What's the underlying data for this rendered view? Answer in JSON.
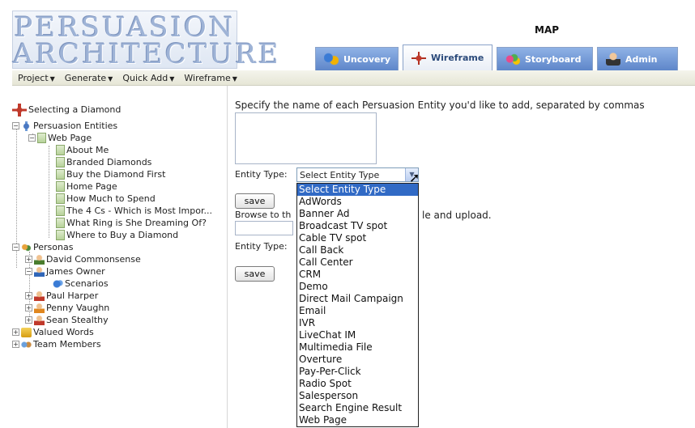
{
  "logo": {
    "line1": "PERSUASION",
    "line2": "ARCHITECTURE"
  },
  "header": {
    "map_label": "MAP"
  },
  "tabs": [
    {
      "label": "Uncovery",
      "icon": "people-icon"
    },
    {
      "label": "Wireframe",
      "icon": "wireframe-icon",
      "active": true
    },
    {
      "label": "Storyboard",
      "icon": "storyboard-icon"
    },
    {
      "label": "Admin",
      "icon": "admin-icon"
    }
  ],
  "menubar": [
    {
      "label": "Project"
    },
    {
      "label": "Generate"
    },
    {
      "label": "Quick Add"
    },
    {
      "label": "Wireframe"
    }
  ],
  "tree": {
    "root": "Selecting a Diamond",
    "entities": "Persuasion Entities",
    "web_page": "Web Page",
    "pages": [
      "About Me",
      "Branded Diamonds",
      "Buy the Diamond First",
      "Home Page",
      "How Much to Spend",
      "The 4 Cs - Which is Most Impor...",
      "What Ring is She Dreaming Of?",
      "Where to Buy a Diamond"
    ],
    "personas": "Personas",
    "persona_list": {
      "david": "David Commonsense",
      "james": "James Owner",
      "scenarios": "Scenarios",
      "paul": "Paul Harper",
      "penny": "Penny Vaughn",
      "sean": "Sean Stealthy"
    },
    "valued_words": "Valued Words",
    "team_members": "Team Members"
  },
  "form": {
    "instruction": "Specify the name of each Persuasion Entity you'd like to add, separated by commas",
    "entity_type_label": "Entity Type:",
    "entity_type_selected": "Select Entity Type",
    "save_label": "save",
    "browse_text": "Browse to th",
    "upload_tail": "le and upload.",
    "entity_type_label_2": "Entity Type:",
    "save_label_2": "save"
  },
  "dropdown_options": [
    "Select Entity Type",
    "AdWords",
    "Banner Ad",
    "Broadcast TV spot",
    "Cable TV spot",
    "Call Back",
    "Call Center",
    "CRM",
    "Demo",
    "Direct Mail Campaign",
    "Email",
    "IVR",
    "LiveChat IM",
    "Multimedia File",
    "Overture",
    "Pay-Per-Click",
    "Radio Spot",
    "Salesperson",
    "Search Engine Result",
    "Web Page"
  ],
  "colors": {
    "tab_active_text": "#2b4a7a",
    "tab_bg": "#5e86c9",
    "selection": "#316ac5",
    "logo": "#9eb3d6"
  }
}
